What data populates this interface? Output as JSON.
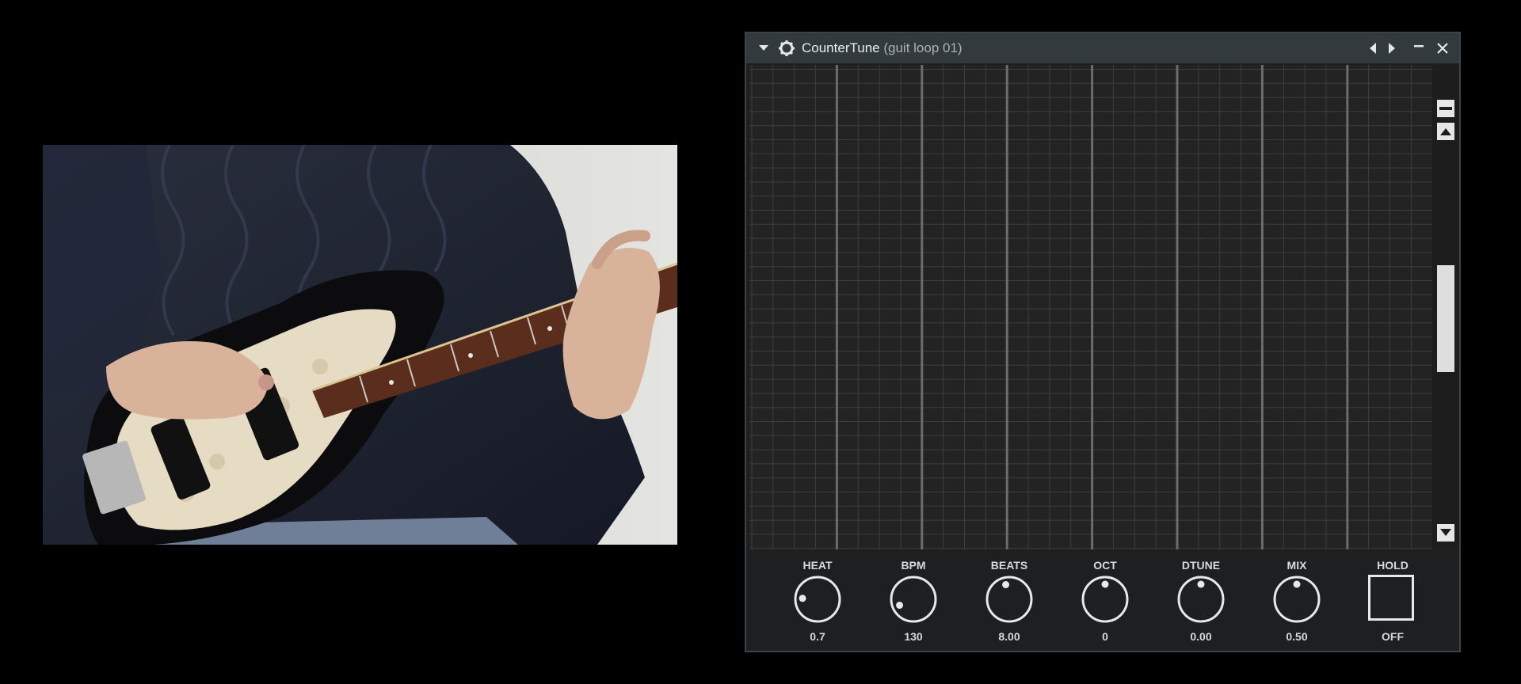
{
  "window": {
    "title": "CounterTune",
    "subtitle": "(guit loop 01)"
  },
  "icons": {
    "menu": "triangle-down-icon",
    "plugin": "gear-icon",
    "prev": "arrow-left-icon",
    "next": "arrow-right-icon",
    "minimize": "minimize-icon",
    "close": "close-icon"
  },
  "controls": [
    {
      "label": "HEAT",
      "value": "0.7",
      "position": 0.18
    },
    {
      "label": "BPM",
      "value": "130",
      "position": 0.08
    },
    {
      "label": "BEATS",
      "value": "8.00",
      "position": 0.45
    },
    {
      "label": "OCT",
      "value": "0",
      "position": 0.5
    },
    {
      "label": "DTUNE",
      "value": "0.00",
      "position": 0.5
    },
    {
      "label": "MIX",
      "value": "0.50",
      "position": 0.5
    }
  ],
  "hold": {
    "label": "HOLD",
    "value": "OFF"
  },
  "scroll_position": 0.45,
  "colors": {
    "background": "#000000",
    "window": "#1d1f20",
    "titlebar": "#323a3e",
    "grid_bg": "#232323",
    "grid_line": "#3e3e3e",
    "grid_beat_line": "#6c6c6c",
    "control_fg": "#e8e8e8"
  }
}
